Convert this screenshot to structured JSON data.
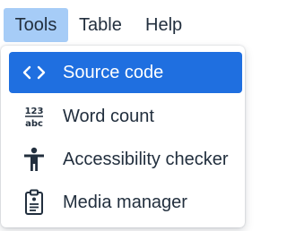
{
  "menubar": {
    "items": [
      {
        "label": "Tools",
        "active": true
      },
      {
        "label": "Table"
      },
      {
        "label": "Help"
      }
    ]
  },
  "dropdown": {
    "items": [
      {
        "label": "Source code",
        "icon": "code-icon",
        "active": true
      },
      {
        "label": "Word count",
        "icon": "word-count-icon",
        "icon_top": "123",
        "icon_bottom": "abc"
      },
      {
        "label": "Accessibility checker",
        "icon": "accessibility-icon"
      },
      {
        "label": "Media manager",
        "icon": "media-manager-icon"
      }
    ]
  },
  "colors": {
    "menubar_active_bg": "#a6ccf7",
    "menu_item_active_bg": "#1f6fe0",
    "text": "#222f3e",
    "active_text": "#ffffff"
  }
}
